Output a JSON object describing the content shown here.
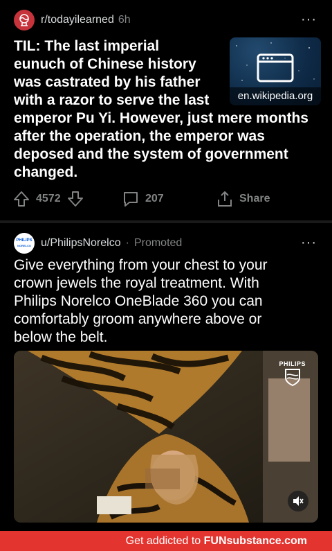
{
  "post1": {
    "subreddit": "r/todayilearned",
    "age": "6h",
    "more": "···",
    "title": "TIL: The last imperial eunuch of Chinese history was castrated by his father with a razor to serve the last emperor Pu Yi. However, just mere months after the operation, the emperor was deposed and the system of government changed.",
    "title_lines": [
      "TIL: The last imperial",
      "eunuch of Chinese history",
      "was castrated by his father",
      "with a razor to serve the last",
      "emperor Pu Yi. However, just mere months",
      "after the operation, the emperor was",
      "deposed and the system of government",
      "changed."
    ],
    "link_domain": "en.wikipedia.org",
    "votes": "4572",
    "comments": "207",
    "share_label": "Share"
  },
  "post2": {
    "user": "u/PhilipsNorelco",
    "separator": "·",
    "promoted_label": "Promoted",
    "more": "···",
    "avatar_brand_top": "PHILIPS",
    "avatar_brand_bottom": "NORELCO",
    "title_lines": [
      "Give everything from your chest to your",
      "crown jewels the royal treatment. With",
      "Philips Norelco OneBlade 360 you can",
      "comfortably groom anywhere above or",
      "below the belt."
    ],
    "video_brand": "PHILIPS"
  },
  "footer": {
    "prefix": "Get addicted to ",
    "brand": "FUNsubstance.com"
  },
  "colors": {
    "background": "#000000",
    "subreddit_avatar": "#c6333a",
    "footer": "#e3342f",
    "muted_text": "#818384"
  },
  "icons": [
    "todayilearned-avatar-icon",
    "upvote-icon",
    "downvote-icon",
    "comment-icon",
    "share-icon",
    "website-icon",
    "mute-icon",
    "philips-shield-icon"
  ]
}
